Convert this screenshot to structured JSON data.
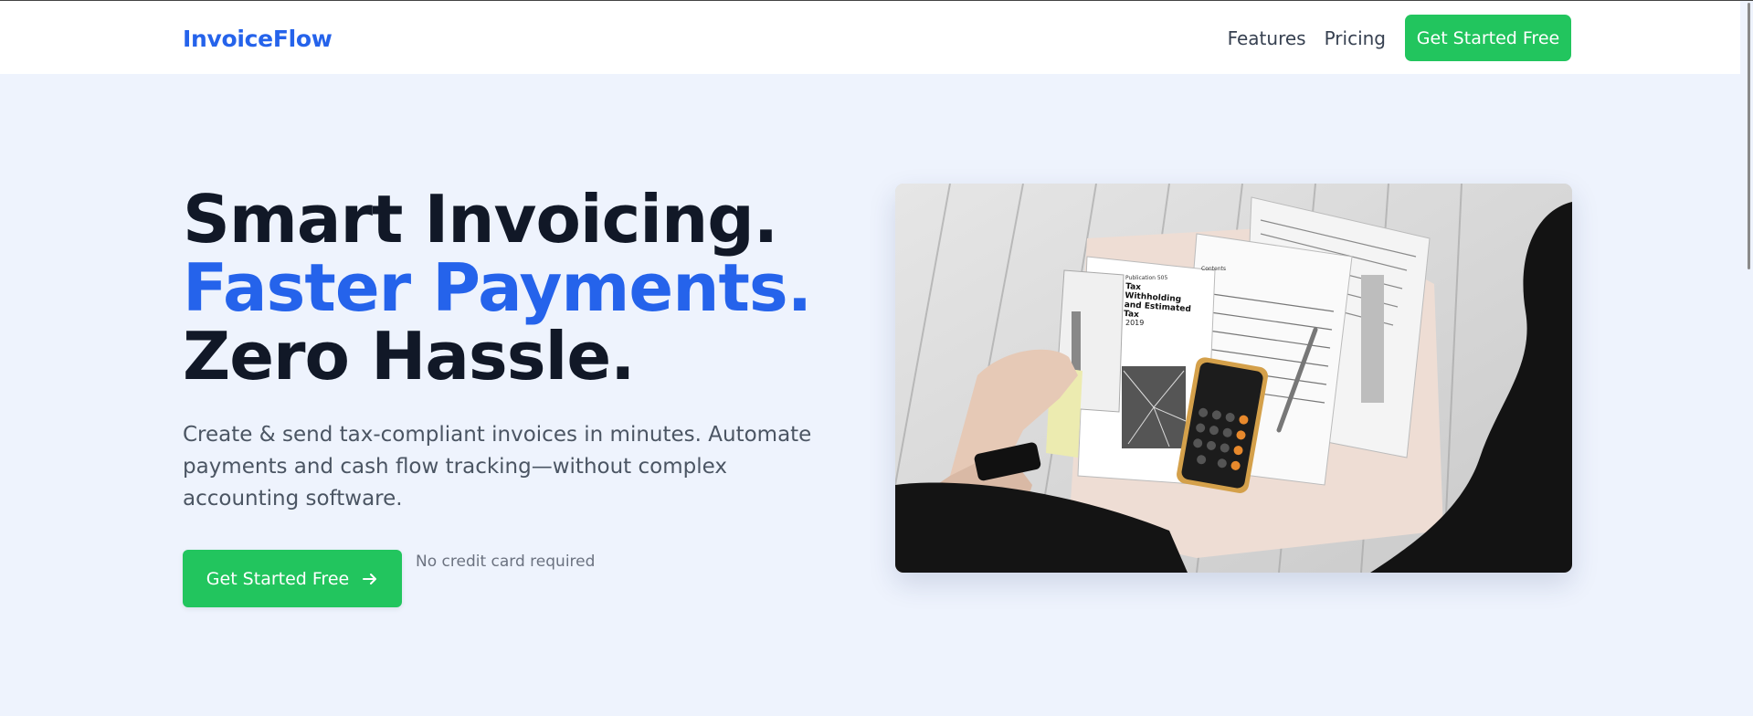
{
  "nav": {
    "logo": "InvoiceFlow",
    "links": [
      "Features",
      "Pricing"
    ],
    "cta": "Get Started Free"
  },
  "hero": {
    "title_line1": "Smart Invoicing.",
    "title_line2": "Faster Payments.",
    "title_line3": "Zero Hassle.",
    "subtitle": "Create & send tax-compliant invoices in minutes. Automate payments and cash flow tracking—without complex accounting software.",
    "cta": "Get Started Free",
    "note": "No credit card required",
    "image": {
      "form_title": "Tax Withholding and Estimated Tax",
      "form_publication": "Publication 505",
      "form_year": "2019",
      "contents_label": "Contents"
    }
  },
  "colors": {
    "brand": "#2563eb",
    "cta": "#22c55e",
    "hero_bg": "#eef3fd",
    "heading": "#111827"
  }
}
